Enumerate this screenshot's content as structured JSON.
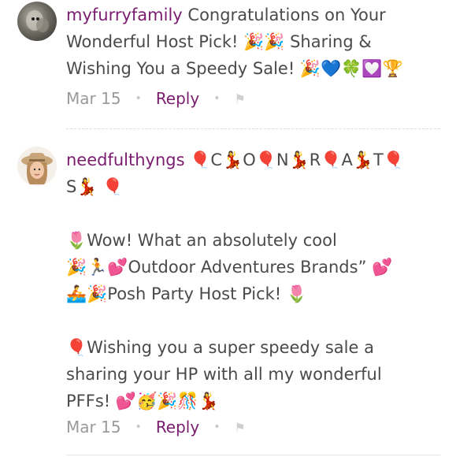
{
  "comments": [
    {
      "username": "myfurryfamily",
      "text": " Congratulations on Your Wonderful Host Pick! 🎉🎉 Sharing & Wishing You a Speedy Sale! 🎉💙🍀💟🏆",
      "date": "Mar 15",
      "reply_label": "Reply",
      "avatar_icon": "dog-photo-avatar",
      "flag_icon": "flag-icon"
    },
    {
      "username": "needfulthyngs",
      "text": " 🎈C💃O🎈N💃R🎈A💃T🎈\nS💃 🎈\n\n🌷Wow! What an absolutely cool\n🎉🏃💕Outdoor Adventures Brands” 💕\n🚣🎉Posh Party Host Pick! 🌷\n\n🎈Wishing you a super speedy sale a\nsharing your HP with all my wonderful\nPFFs! 💕🥳🎉🎊💃",
      "date": "Mar 15",
      "reply_label": "Reply",
      "avatar_icon": "woman-hat-avatar",
      "flag_icon": "flag-icon"
    }
  ]
}
